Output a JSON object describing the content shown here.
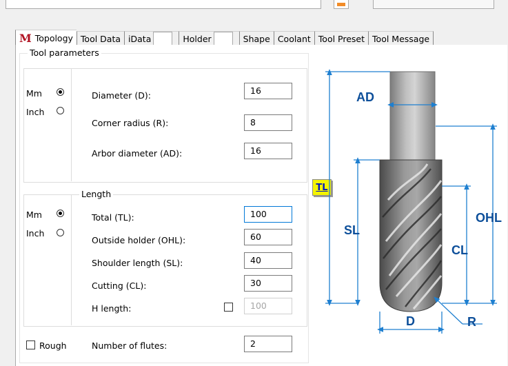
{
  "tabs": [
    "Topology",
    "Tool Data",
    "iData",
    "Holder",
    "Shape",
    "Coolant",
    "Tool Preset",
    "Tool Message"
  ],
  "logo_text": "M",
  "tool_parameters": {
    "title": "Tool parameters",
    "unit_mm": "Mm",
    "unit_inch": "Inch",
    "unit_selected": "Mm",
    "diameter_label": "Diameter (D):",
    "diameter": "16",
    "corner_radius_label": "Corner radius (R):",
    "corner_radius": "8",
    "arbor_label": "Arbor diameter (AD):",
    "arbor": "16"
  },
  "length": {
    "title": "Length",
    "unit_mm": "Mm",
    "unit_inch": "Inch",
    "unit_selected": "Mm",
    "total_label": "Total (TL):",
    "total": "100",
    "ohl_label": "Outside holder (OHL):",
    "ohl": "60",
    "shoulder_label": "Shoulder length (SL):",
    "shoulder": "40",
    "cutting_label": "Cutting (CL):",
    "cutting": "30",
    "h_length_label": "H length:",
    "h_length": "100",
    "h_length_checked": false
  },
  "rough": {
    "label": "Rough",
    "checked": false
  },
  "flutes": {
    "label": "Number of flutes:",
    "value": "2"
  },
  "diagram": {
    "label_ad": "AD",
    "label_tl": "TL",
    "label_sl": "SL",
    "label_ohl": "OHL",
    "label_cl": "CL",
    "label_d": "D",
    "label_r": "R",
    "dim_color": "#1e7fd0",
    "label_color": "#0d4f9a"
  }
}
